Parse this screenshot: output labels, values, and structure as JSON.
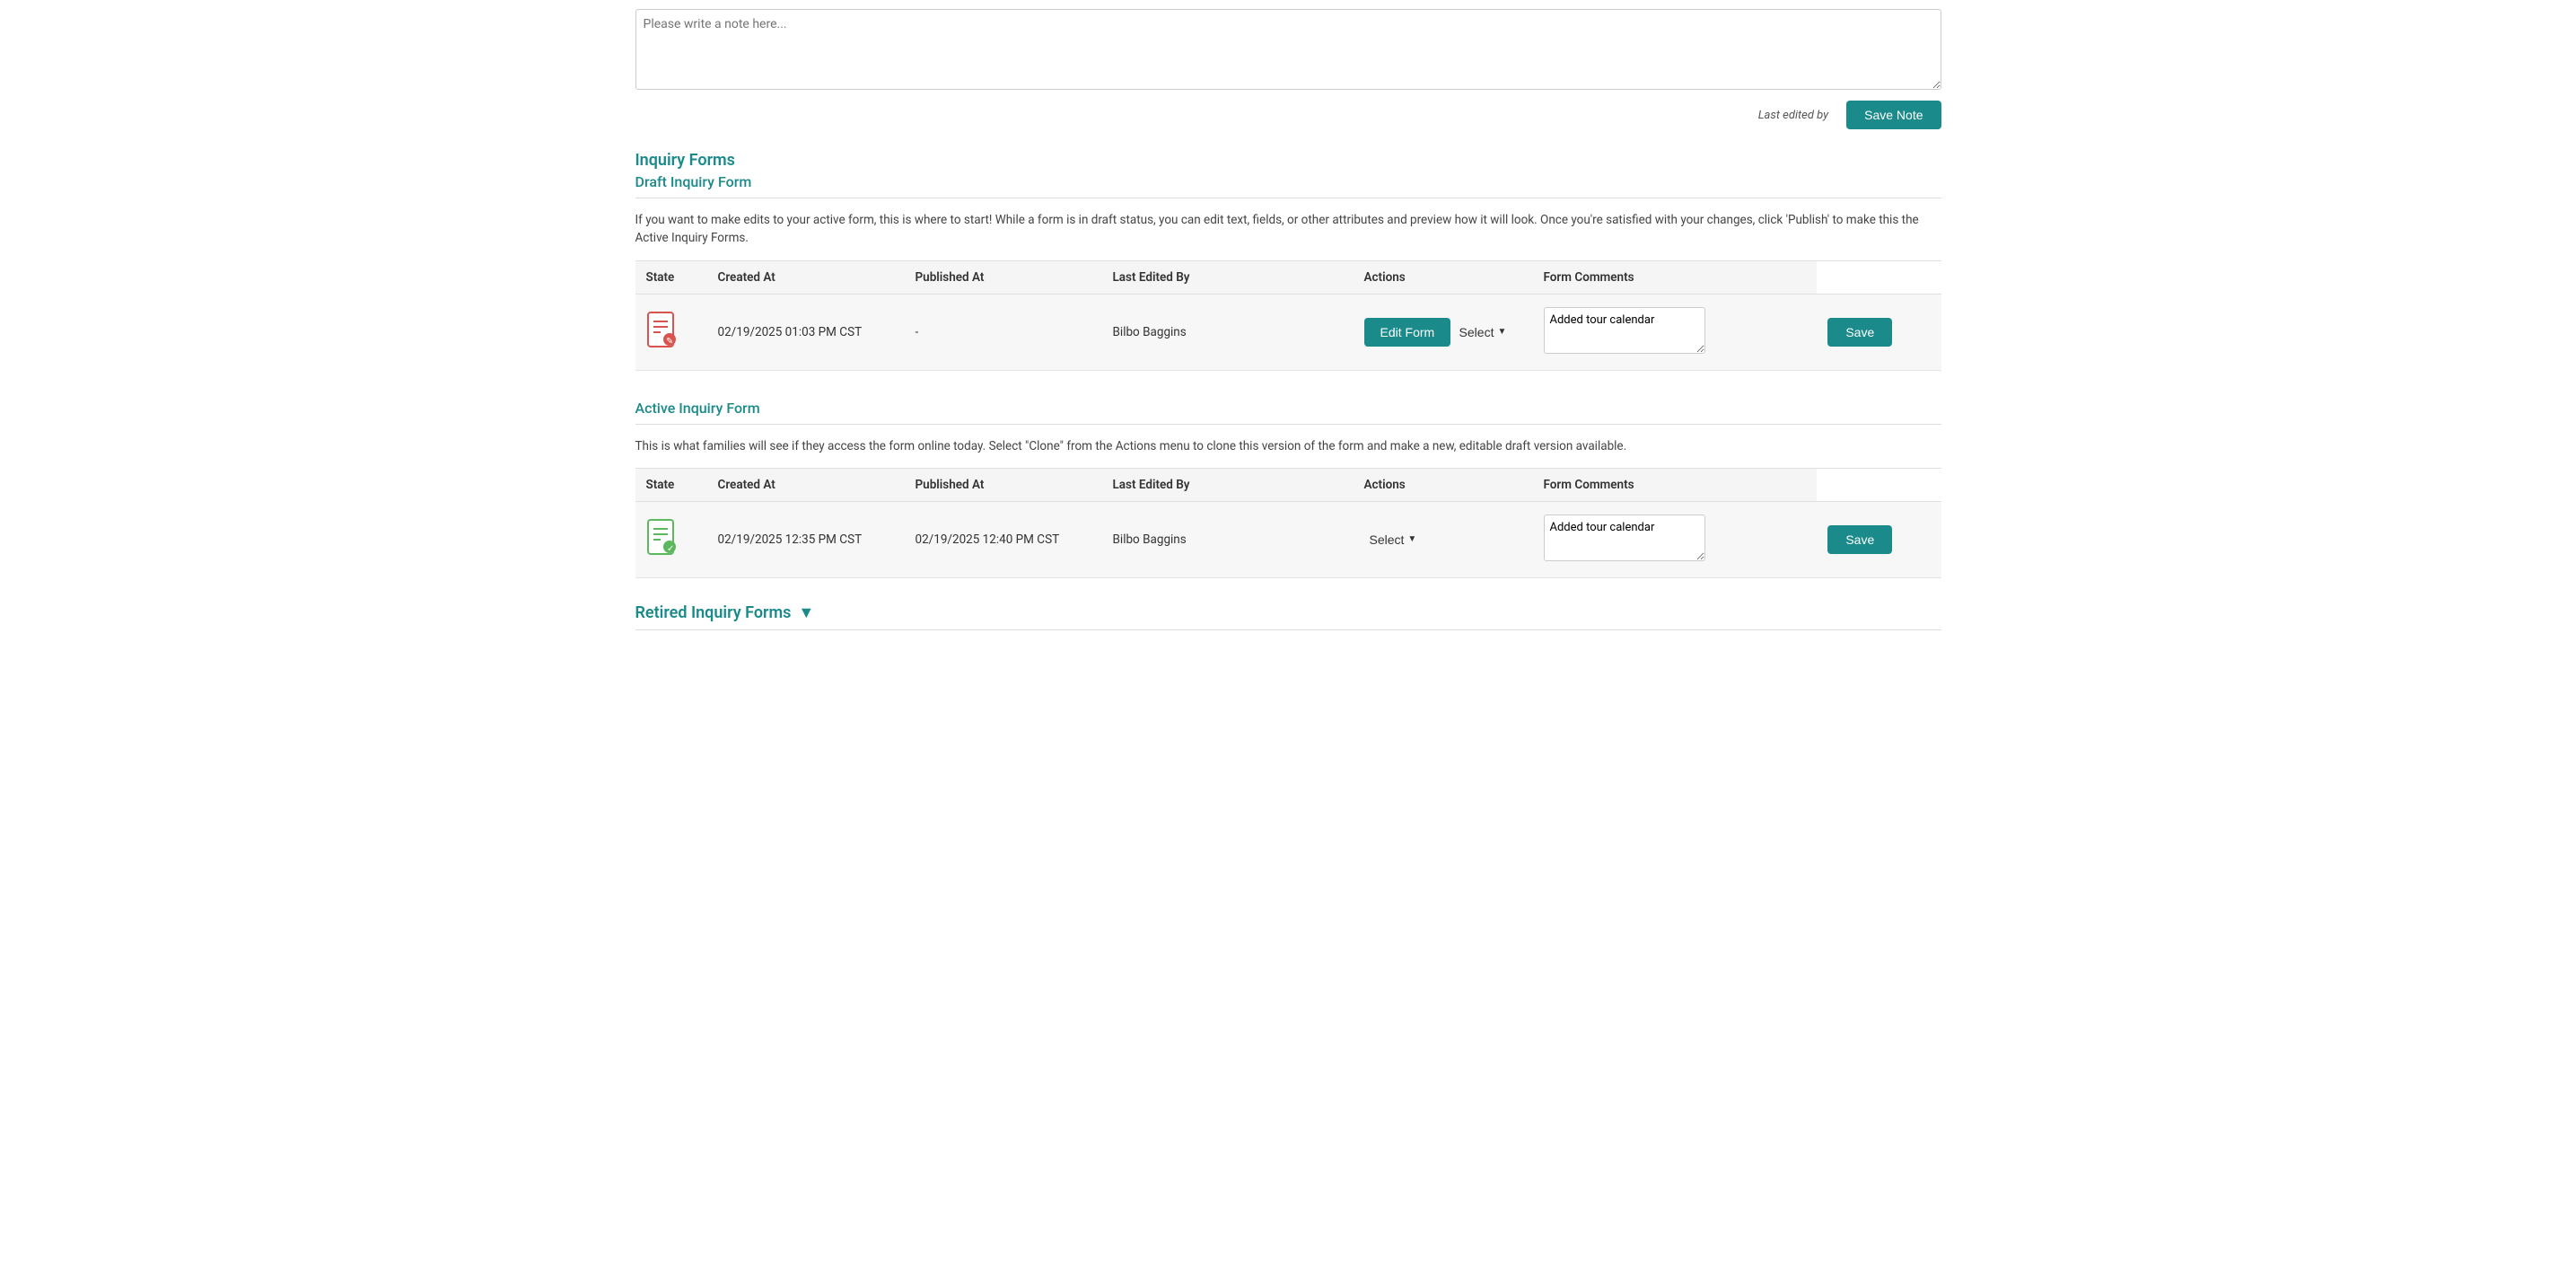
{
  "note": {
    "placeholder": "Please write a note here...",
    "save_label": "Save Note",
    "last_edited_label": "Last edited by"
  },
  "inquiry_forms": {
    "section_title": "Inquiry Forms",
    "draft_section": {
      "subtitle": "Draft Inquiry Form",
      "description": "If you want to make edits to your active form, this is where to start! While a form is in draft status, you can edit text, fields, or other attributes and preview how it will look. Once you're satisfied with your changes, click 'Publish' to make this the Active Inquiry Forms.",
      "table_headers": {
        "state": "State",
        "created_at": "Created At",
        "published_at": "Published At",
        "last_edited_by": "Last Edited By",
        "actions": "Actions",
        "form_comments": "Form Comments"
      },
      "rows": [
        {
          "state": "draft",
          "created_at": "02/19/2025 01:03 PM CST",
          "published_at": "-",
          "last_edited_by": "Bilbo Baggins",
          "edit_form_label": "Edit Form",
          "select_label": "Select",
          "comment_value": "Added tour calendar",
          "save_label": "Save"
        }
      ]
    },
    "active_section": {
      "subtitle": "Active Inquiry Form",
      "description": "This is what families will see if they access the form online today. Select \"Clone\" from the Actions menu to clone this version of the form and make a new, editable draft version available.",
      "table_headers": {
        "state": "State",
        "created_at": "Created At",
        "published_at": "Published At",
        "last_edited_by": "Last Edited By",
        "actions": "Actions",
        "form_comments": "Form Comments"
      },
      "rows": [
        {
          "state": "active",
          "created_at": "02/19/2025 12:35 PM CST",
          "published_at": "02/19/2025 12:40 PM CST",
          "last_edited_by": "Bilbo Baggins",
          "select_label": "Select",
          "comment_value": "Added tour calendar",
          "save_label": "Save"
        }
      ]
    },
    "retired_section": {
      "title": "Retired Inquiry Forms",
      "chevron_icon": "▼"
    }
  }
}
